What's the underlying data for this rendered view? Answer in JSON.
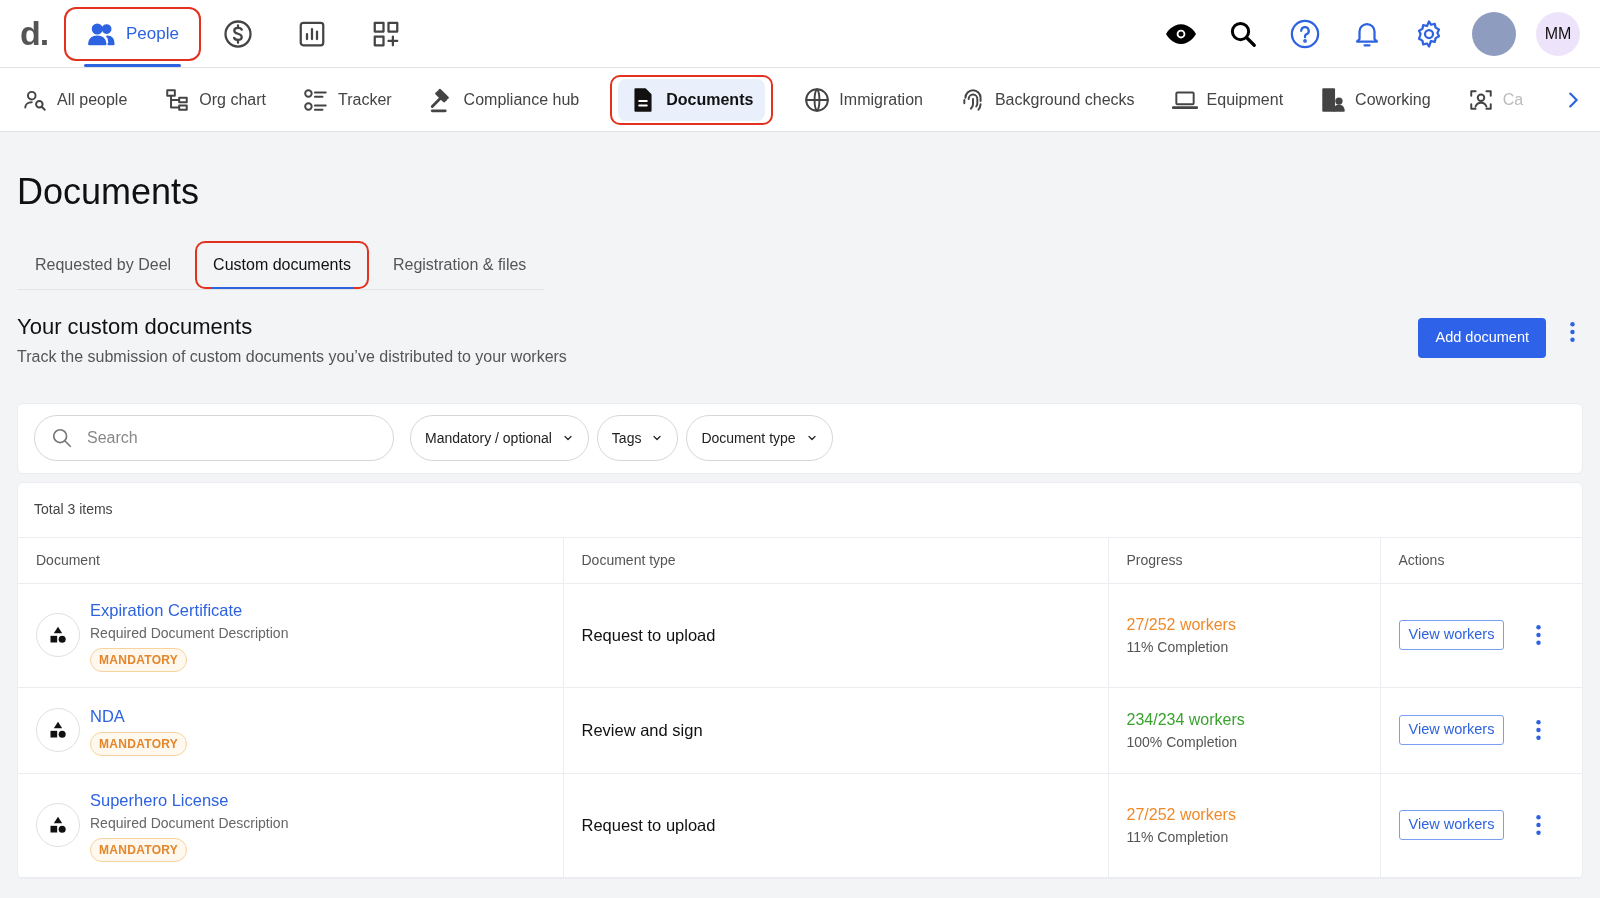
{
  "top_nav": {
    "logo": "d.",
    "items": [
      {
        "label": "People",
        "selected": true,
        "highlighted": true
      },
      {
        "selected": false,
        "highlighted": false
      },
      {
        "selected": false,
        "highlighted": false
      },
      {
        "selected": false,
        "highlighted": false
      }
    ],
    "avatar_initials": "MM"
  },
  "sub_nav": {
    "items": [
      {
        "label": "All people",
        "selected": false,
        "highlighted": false,
        "faded": false
      },
      {
        "label": "Org chart",
        "selected": false,
        "highlighted": false,
        "faded": false
      },
      {
        "label": "Tracker",
        "selected": false,
        "highlighted": false,
        "faded": false
      },
      {
        "label": "Compliance hub",
        "selected": false,
        "highlighted": false,
        "faded": false
      },
      {
        "label": "Documents",
        "selected": true,
        "highlighted": true,
        "faded": false
      },
      {
        "label": "Immigration",
        "selected": false,
        "highlighted": false,
        "faded": false
      },
      {
        "label": "Background checks",
        "selected": false,
        "highlighted": false,
        "faded": false
      },
      {
        "label": "Equipment",
        "selected": false,
        "highlighted": false,
        "faded": false
      },
      {
        "label": "Coworking",
        "selected": false,
        "highlighted": false,
        "faded": false
      },
      {
        "label": "Ca",
        "selected": false,
        "highlighted": false,
        "faded": true
      }
    ]
  },
  "page_title": "Documents",
  "tabs": [
    {
      "label": "Requested by Deel",
      "selected": false,
      "highlighted": false
    },
    {
      "label": "Custom documents",
      "selected": true,
      "highlighted": true
    },
    {
      "label": "Registration & files",
      "selected": false,
      "highlighted": false
    }
  ],
  "section": {
    "title": "Your custom documents",
    "subtitle": "Track the submission of custom documents you’ve distributed to your workers",
    "primary_button": "Add document"
  },
  "filters": {
    "search_placeholder": "Search",
    "dropdowns": [
      "Mandatory / optional",
      "Tags",
      "Document type"
    ]
  },
  "table": {
    "total": "Total 3 items",
    "columns": [
      "Document",
      "Document type",
      "Progress",
      "Actions"
    ],
    "rows": [
      {
        "name": "Expiration Certificate",
        "description": "Required Document Description",
        "tag": "MANDATORY",
        "type": "Request to upload",
        "workers": "27/252 workers",
        "completion": "11% Completion",
        "color": "#ef8a2b",
        "action": "View workers"
      },
      {
        "name": "NDA",
        "tag": "MANDATORY",
        "type": "Review and sign",
        "workers": "234/234 workers",
        "completion": "100% Completion",
        "color": "#3aa22f",
        "action": "View workers"
      },
      {
        "name": "Superhero License",
        "description": "Required Document Description",
        "tag": "MANDATORY",
        "type": "Request to upload",
        "workers": "27/252 workers",
        "completion": "11% Completion",
        "color": "#ef8a2b",
        "action": "View workers"
      }
    ]
  }
}
